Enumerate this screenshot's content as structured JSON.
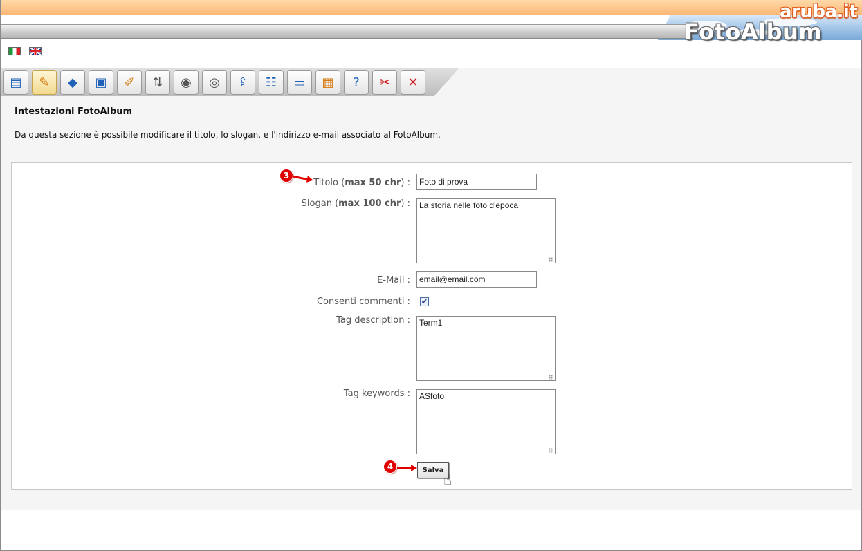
{
  "header": {
    "brand_top": "aruba.it",
    "brand_main": "FotoAlbum"
  },
  "languages": [
    {
      "name": "Italiano",
      "icon": "italy-flag-icon"
    },
    {
      "name": "English",
      "icon": "uk-flag-icon"
    }
  ],
  "toolbar": {
    "tools": [
      {
        "icon": "album-settings-icon"
      },
      {
        "icon": "edit-header-icon"
      },
      {
        "icon": "theme-icon"
      },
      {
        "icon": "add-photo-icon"
      },
      {
        "icon": "edit-photo-icon"
      },
      {
        "icon": "sort-icon"
      },
      {
        "icon": "add-video-icon"
      },
      {
        "icon": "edit-video-icon"
      },
      {
        "icon": "upload-icon"
      },
      {
        "icon": "categories-icon"
      },
      {
        "icon": "display-icon"
      },
      {
        "icon": "package-icon"
      },
      {
        "icon": "help-icon"
      },
      {
        "icon": "tools-icon"
      },
      {
        "icon": "delete-icon"
      }
    ]
  },
  "section": {
    "title": "Intestazioni FotoAlbum",
    "description": "Da questa sezione è possibile modificare il titolo, lo slogan, e l'indirizzo e-mail associato al FotoAlbum."
  },
  "form": {
    "titolo": {
      "label_pre": "Titolo (",
      "label_bold": "max 50 chr",
      "label_post": ") :",
      "value": "Foto di prova"
    },
    "slogan": {
      "label_pre": "Slogan (",
      "label_bold": "max 100 chr",
      "label_post": ") :",
      "value": "La storia nelle foto d'epoca"
    },
    "email": {
      "label": "E-Mail :",
      "value": "email@email.com"
    },
    "comments": {
      "label": "Consenti commenti :",
      "checked": true,
      "check_glyph": "✔"
    },
    "tag_description": {
      "label": "Tag description :",
      "value": "Term1"
    },
    "tag_keywords": {
      "label": "Tag keywords :",
      "value": "ASfoto"
    },
    "save_label": "Salva"
  },
  "annotations": {
    "marker_3": "3",
    "marker_4": "4"
  }
}
